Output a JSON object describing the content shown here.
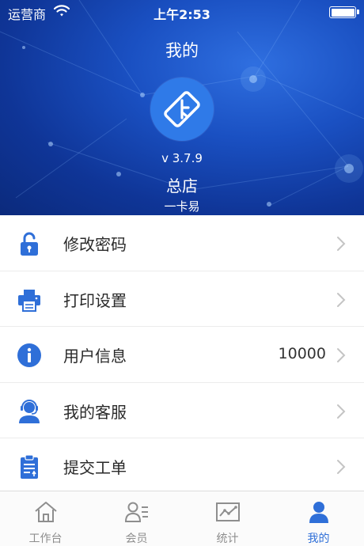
{
  "status_bar": {
    "carrier": "运营商",
    "time": "上午2:53"
  },
  "header": {
    "title": "我的",
    "version": "v 3.7.9",
    "store_name": "总店",
    "brand": "一卡易"
  },
  "menu": {
    "items": [
      {
        "label": "修改密码",
        "icon": "lock-icon",
        "value": ""
      },
      {
        "label": "打印设置",
        "icon": "printer-icon",
        "value": ""
      },
      {
        "label": "用户信息",
        "icon": "info-icon",
        "value": "10000"
      },
      {
        "label": "我的客服",
        "icon": "customer-service-icon",
        "value": ""
      },
      {
        "label": "提交工单",
        "icon": "clipboard-icon",
        "value": ""
      }
    ]
  },
  "tabbar": {
    "tabs": [
      {
        "label": "工作台",
        "icon": "home-icon",
        "active": false
      },
      {
        "label": "会员",
        "icon": "member-icon",
        "active": false
      },
      {
        "label": "统计",
        "icon": "chart-icon",
        "active": false
      },
      {
        "label": "我的",
        "icon": "profile-icon",
        "active": true
      }
    ]
  },
  "colors": {
    "accent": "#2f6fd8",
    "header_dark": "#0b2a7c",
    "header_light": "#2f6fe0",
    "icon_blue": "#2f6fd8",
    "inactive_tab": "#8e8e8e"
  }
}
